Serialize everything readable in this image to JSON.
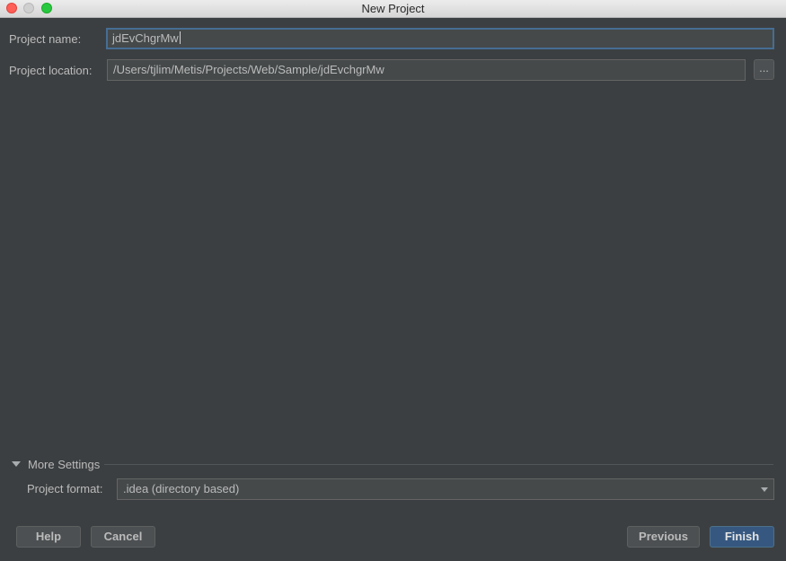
{
  "window": {
    "title": "New Project"
  },
  "form": {
    "project_name_label": "Project name:",
    "project_name_value": "jdEvChgrMw",
    "project_location_label": "Project location:",
    "project_location_value": "/Users/tjlim/Metis/Projects/Web/Sample/jdEvchgrMw",
    "browse_label": "..."
  },
  "more_settings": {
    "label": "More Settings",
    "expanded": true,
    "project_format_label": "Project format:",
    "project_format_value": ".idea (directory based)"
  },
  "buttons": {
    "help": "Help",
    "cancel": "Cancel",
    "previous": "Previous",
    "finish": "Finish"
  },
  "colors": {
    "background": "#3c3f41",
    "field_background": "#45494a",
    "focus_border": "#466d94",
    "primary_button": "#365880",
    "text": "#bbbbbb"
  }
}
